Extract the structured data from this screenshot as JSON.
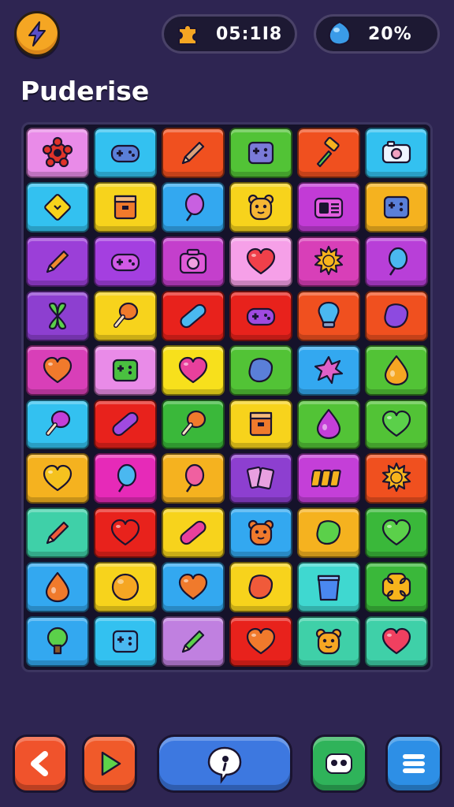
{
  "header": {
    "bolt_icon": "lightning-bolt-icon",
    "timer_icon": "puzzle-piece-icon",
    "timer_value": "05:1I8",
    "gem_icon": "blue-gem-icon",
    "gem_value": "20%"
  },
  "title": "Puderise",
  "board": {
    "columns": 6,
    "rows": 10,
    "tiles": [
      {
        "color": "#e98be8",
        "icon": "gear-flower",
        "icolor": "#e0332a"
      },
      {
        "color": "#33c1f0",
        "icon": "gamepad",
        "icolor": "#5a7fd8"
      },
      {
        "color": "#f0501f",
        "icon": "pencil",
        "icolor": "#d9a27a"
      },
      {
        "color": "#52c336",
        "icon": "controller-box",
        "icolor": "#7a7ad8"
      },
      {
        "color": "#f0501f",
        "icon": "hammer",
        "icolor": "#5bd04a"
      },
      {
        "color": "#33c1f0",
        "icon": "camera-controller",
        "icolor": "#eef4ff"
      },
      {
        "color": "#33c1f0",
        "icon": "diamond-sign",
        "icolor": "#f7d31c"
      },
      {
        "color": "#f7d31c",
        "icon": "box",
        "icolor": "#f07a2c"
      },
      {
        "color": "#33a8f0",
        "icon": "balloon",
        "icolor": "#c860e0"
      },
      {
        "color": "#f7d31c",
        "icon": "bear-face",
        "icolor": "#f5b634"
      },
      {
        "color": "#c23bd6",
        "icon": "radio",
        "icolor": "#e45fe0"
      },
      {
        "color": "#f5b21f",
        "icon": "controller-box",
        "icolor": "#5a7fd8"
      },
      {
        "color": "#9b3fd8",
        "icon": "pencil",
        "icolor": "#f08a2c"
      },
      {
        "color": "#a43fe0",
        "icon": "gamepad",
        "icolor": "#d05ae6"
      },
      {
        "color": "#c43fcc",
        "icon": "camera",
        "icolor": "#e05ad8"
      },
      {
        "color": "#f6a0e8",
        "icon": "heart",
        "icolor": "#f0404a"
      },
      {
        "color": "#d83fb8",
        "icon": "sun",
        "icolor": "#f7b41c"
      },
      {
        "color": "#b83fd8",
        "icon": "balloon",
        "icolor": "#4ab8f0"
      },
      {
        "color": "#8d3fd0",
        "icon": "leaf",
        "icolor": "#5bd04a"
      },
      {
        "color": "#f7d31c",
        "icon": "drumstick",
        "icolor": "#f07a2c"
      },
      {
        "color": "#e8221c",
        "icon": "pill",
        "icolor": "#4ab8f0"
      },
      {
        "color": "#e8221c",
        "icon": "gamepad",
        "icolor": "#a04ae0"
      },
      {
        "color": "#f0501f",
        "icon": "bulb",
        "icolor": "#4ab8f0"
      },
      {
        "color": "#f0501f",
        "icon": "blob",
        "icolor": "#8d4ae0"
      },
      {
        "color": "#d83fb8",
        "icon": "heart",
        "icolor": "#f07a2c"
      },
      {
        "color": "#e98be8",
        "icon": "controller-box",
        "icolor": "#4ac040"
      },
      {
        "color": "#f7e01c",
        "icon": "heart",
        "icolor": "#e8409c"
      },
      {
        "color": "#52c336",
        "icon": "blob",
        "icolor": "#5a7fd8"
      },
      {
        "color": "#33a8f0",
        "icon": "splash",
        "icolor": "#e060c8"
      },
      {
        "color": "#52c336",
        "icon": "drop",
        "icolor": "#f5a623"
      },
      {
        "color": "#33c1f0",
        "icon": "drumstick",
        "icolor": "#c43fd8"
      },
      {
        "color": "#e8221c",
        "icon": "pill",
        "icolor": "#a04ae0"
      },
      {
        "color": "#3ab83a",
        "icon": "drumstick",
        "icolor": "#f07a2c"
      },
      {
        "color": "#f7d31c",
        "icon": "box",
        "icolor": "#f07a2c"
      },
      {
        "color": "#52c336",
        "icon": "drop",
        "icolor": "#c43fd8"
      },
      {
        "color": "#52c336",
        "icon": "heart",
        "icolor": "#5bd04a"
      },
      {
        "color": "#f5b21f",
        "icon": "heart",
        "icolor": "#f5c21f"
      },
      {
        "color": "#e62ab8",
        "icon": "balloon",
        "icolor": "#4ab8f0"
      },
      {
        "color": "#f5b21f",
        "icon": "balloon",
        "icolor": "#f060a0"
      },
      {
        "color": "#8d3fd0",
        "icon": "cards",
        "icolor": "#e8a0e0"
      },
      {
        "color": "#c43fd8",
        "icon": "tickets",
        "icolor": "#f5b21f"
      },
      {
        "color": "#f0501f",
        "icon": "sun",
        "icolor": "#f7b41c"
      },
      {
        "color": "#3fd0a8",
        "icon": "pencil",
        "icolor": "#f05a3a"
      },
      {
        "color": "#e8221c",
        "icon": "heart",
        "icolor": "#e8221c"
      },
      {
        "color": "#f7d31c",
        "icon": "pill",
        "icolor": "#e8409c"
      },
      {
        "color": "#33a8f0",
        "icon": "bear-face",
        "icolor": "#f07a2c"
      },
      {
        "color": "#f5b21f",
        "icon": "blob",
        "icolor": "#5bd04a"
      },
      {
        "color": "#3ab83a",
        "icon": "heart",
        "icolor": "#5bd04a"
      },
      {
        "color": "#33a8f0",
        "icon": "drop",
        "icolor": "#f07a2c"
      },
      {
        "color": "#f7d31c",
        "icon": "circle",
        "icolor": "#f5a623"
      },
      {
        "color": "#33a8f0",
        "icon": "heart",
        "icolor": "#f07a2c"
      },
      {
        "color": "#f7d31c",
        "icon": "blob",
        "icolor": "#f05a3a"
      },
      {
        "color": "#3fd8d0",
        "icon": "cup",
        "icolor": "#4a88f0"
      },
      {
        "color": "#3ab83a",
        "icon": "cross-flower",
        "icolor": "#f7b41c"
      },
      {
        "color": "#33a8f0",
        "icon": "tree",
        "icolor": "#5bd04a"
      },
      {
        "color": "#33c1f0",
        "icon": "controller-box",
        "icolor": "#4ab8f0"
      },
      {
        "color": "#c080e0",
        "icon": "pencil",
        "icolor": "#5bd04a"
      },
      {
        "color": "#e8221c",
        "icon": "heart",
        "icolor": "#f07a2c"
      },
      {
        "color": "#3fd0a8",
        "icon": "bear-face",
        "icolor": "#f5a623"
      },
      {
        "color": "#3fd0a8",
        "icon": "heart",
        "icolor": "#f04060"
      }
    ]
  },
  "footer": {
    "back_icon": "back-arrow-icon",
    "play_icon": "play-triangle-icon",
    "hint_icon": "speech-bubble-icon",
    "face_icon": "face-icon",
    "menu_icon": "menu-icon"
  }
}
